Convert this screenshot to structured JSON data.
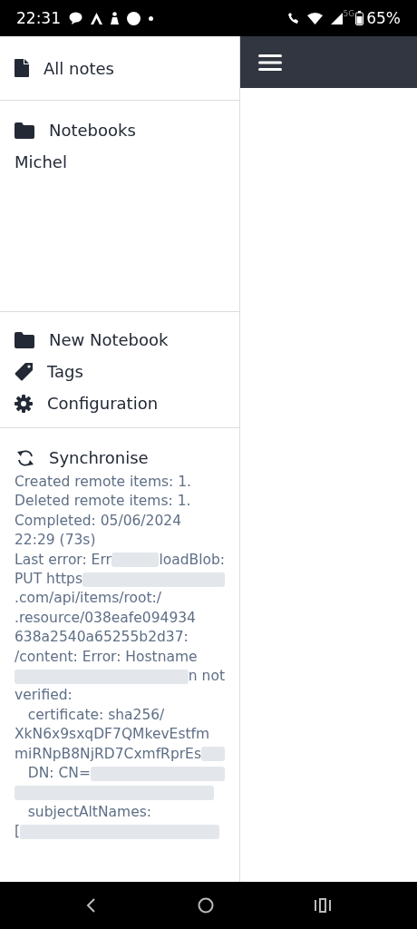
{
  "status_bar": {
    "time": "22:31",
    "battery": "65%",
    "network": "5G"
  },
  "sidebar": {
    "all_notes": "All notes",
    "notebooks_heading": "Notebooks",
    "notebooks": [
      {
        "title": "Michel",
        "selected": false
      }
    ],
    "actions": [
      {
        "kind": "folder",
        "label": "New Notebook"
      },
      {
        "kind": "tag",
        "label": "Tags"
      },
      {
        "kind": "gear",
        "label": "Configuration"
      }
    ],
    "sync_button": "Synchronise",
    "sync_report": [
      [
        {
          "text": "Created remote items: 1."
        }
      ],
      [
        {
          "text": "Deleted remote items: 1."
        }
      ],
      [
        {
          "text": "Completed: 05/06/2024"
        }
      ],
      [
        {
          "text": "22:29 (73s)"
        }
      ],
      [
        {
          "text": "Last error: Err"
        },
        {
          "kind": "redacted"
        },
        {
          "text": "loadBlob:"
        }
      ],
      [
        {
          "text": "PUT https"
        },
        {
          "kind": "redacted"
        }
      ],
      [
        {
          "text": ".com/api/items/root:/"
        }
      ],
      [
        {
          "text": ".resource/038eafe094934"
        }
      ],
      [
        {
          "text": "638a2540a65255b2d37:"
        }
      ],
      [
        {
          "text": "/content: Error: Hostname"
        }
      ],
      [
        {
          "kind": "redacted"
        },
        {
          "text": "n not"
        }
      ],
      [
        {
          "text": "verified:"
        }
      ],
      [
        {
          "text": "   certificate: sha256/"
        }
      ],
      [
        {
          "text": "XkN6x9sxqDF7QMkevEstfm"
        }
      ],
      [
        {
          "text": "miRNpB8NjRD7CxmfRprEs"
        },
        {
          "kind": "redacted"
        }
      ],
      [
        {
          "text": "   DN: CN="
        },
        {
          "kind": "redacted"
        }
      ],
      [
        {
          "kind": "redacted"
        }
      ],
      [
        {
          "text": "   subjectAltNames:"
        }
      ],
      [
        {
          "text": "["
        },
        {
          "kind": "redacted"
        }
      ]
    ]
  }
}
